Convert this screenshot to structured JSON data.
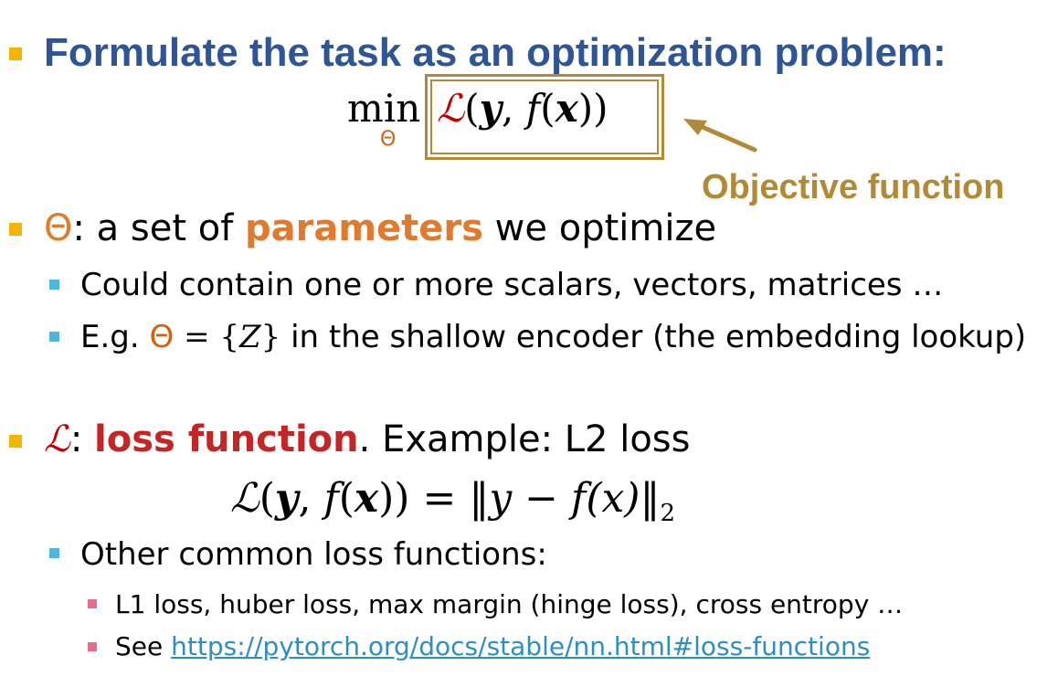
{
  "title": "Formulate the task as an optimization problem:",
  "formula": {
    "min": "min",
    "subscript": "Θ",
    "loss_symbol": "ℒ",
    "open": "(",
    "y": "𝒚",
    "comma": ", ",
    "f": "f",
    "x_open": "(",
    "x": "𝒙",
    "close": "))"
  },
  "objective_label": "Objective function",
  "theta_bullet": {
    "symbol": "Θ",
    "text1": ": a set of ",
    "highlight": "parameters",
    "text2": " we optimize",
    "sub_items": [
      "Could contain one or more scalars, vectors, matrices …",
      {
        "prefix": "E.g. ",
        "symbol": "Θ",
        "eq": " = {",
        "z": "Z",
        "eq_close": "}",
        "suffix": " in the shallow encoder (the embedding lookup)"
      }
    ]
  },
  "loss_bullet": {
    "symbol": "ℒ",
    "colon": ": ",
    "highlight": "loss function",
    "text": ". Example: L2 loss",
    "equation": {
      "lhs_l": "ℒ",
      "lhs_rest_open": "(",
      "y": "𝒚",
      "comma": ", ",
      "f": "f",
      "paren": "(",
      "x": "𝒙",
      "close": "))",
      "eq": " = ‖",
      "y2": "y",
      "minus": " − ",
      "f2": "f",
      "x2": "(x)",
      "norm_close": "‖",
      "sub": "2"
    },
    "sub_heading": "Other common loss functions:",
    "sub_items": [
      "L1 loss, huber loss, max margin (hinge loss), cross entropy …",
      {
        "prefix": "See ",
        "link": "https://pytorch.org/docs/stable/nn.html#loss-functions"
      }
    ]
  },
  "colors": {
    "title": "#2f5597",
    "bullet_l1": "#f4b400",
    "bullet_l2": "#4eb6d9",
    "bullet_l3": "#e36f8c",
    "objective": "#b28a35",
    "parameters": "#e07b2e",
    "loss": "#c42525",
    "link": "#2e8ec2"
  },
  "icons": {
    "arrow": "arrow-left-up-icon"
  }
}
